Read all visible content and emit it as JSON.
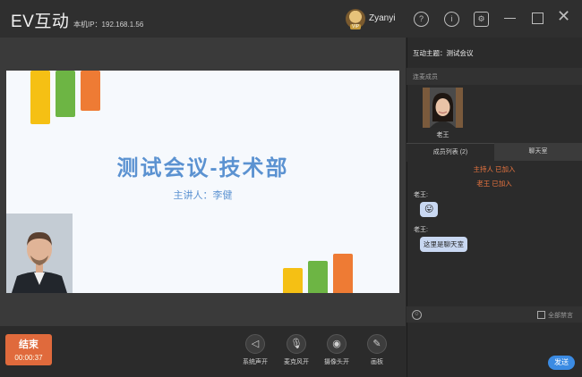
{
  "header": {
    "app_title": "EV互动",
    "ip_text": "本机IP：192.168.1.56",
    "vip_badge": "VIP",
    "username": "Zyanyi",
    "icons": [
      "help-icon",
      "info-icon",
      "settings-icon",
      "minimize-icon",
      "maximize-icon",
      "close-icon"
    ],
    "help_glyph": "?",
    "info_glyph": "i",
    "settings_glyph": "⚙",
    "close_glyph": "✕"
  },
  "slide": {
    "title": "测试会议-技术部",
    "subtitle": "主讲人：李健",
    "colors": {
      "yellow": "#f5c014",
      "green": "#6db544",
      "orange": "#ee7b34",
      "title": "#5b92d1"
    }
  },
  "controls": {
    "end_label": "结束",
    "end_time": "00:00:37",
    "buttons": [
      {
        "label": "系统声开",
        "icon": "speaker-icon",
        "glyph": "◁"
      },
      {
        "label": "麦克风开",
        "icon": "microphone-icon",
        "glyph": "🎙"
      },
      {
        "label": "摄像头开",
        "icon": "camera-icon",
        "glyph": "◉"
      },
      {
        "label": "画板",
        "icon": "palette-icon",
        "glyph": "✎"
      }
    ]
  },
  "panel": {
    "topic": "互动主题：测试会议",
    "members_section": "连麦成员",
    "member_name": "老王",
    "tabs": [
      "成员列表 (2)",
      "聊天室"
    ],
    "system_messages": [
      "主持人  已加入",
      "老王  已加入"
    ],
    "messages": [
      {
        "sender": "老王:",
        "text": "😛"
      },
      {
        "sender": "老王:",
        "text": "这里是聊天室"
      }
    ],
    "emoji_glyph": "☺",
    "mute_all_label": "全部禁言",
    "send_label": "发送"
  }
}
